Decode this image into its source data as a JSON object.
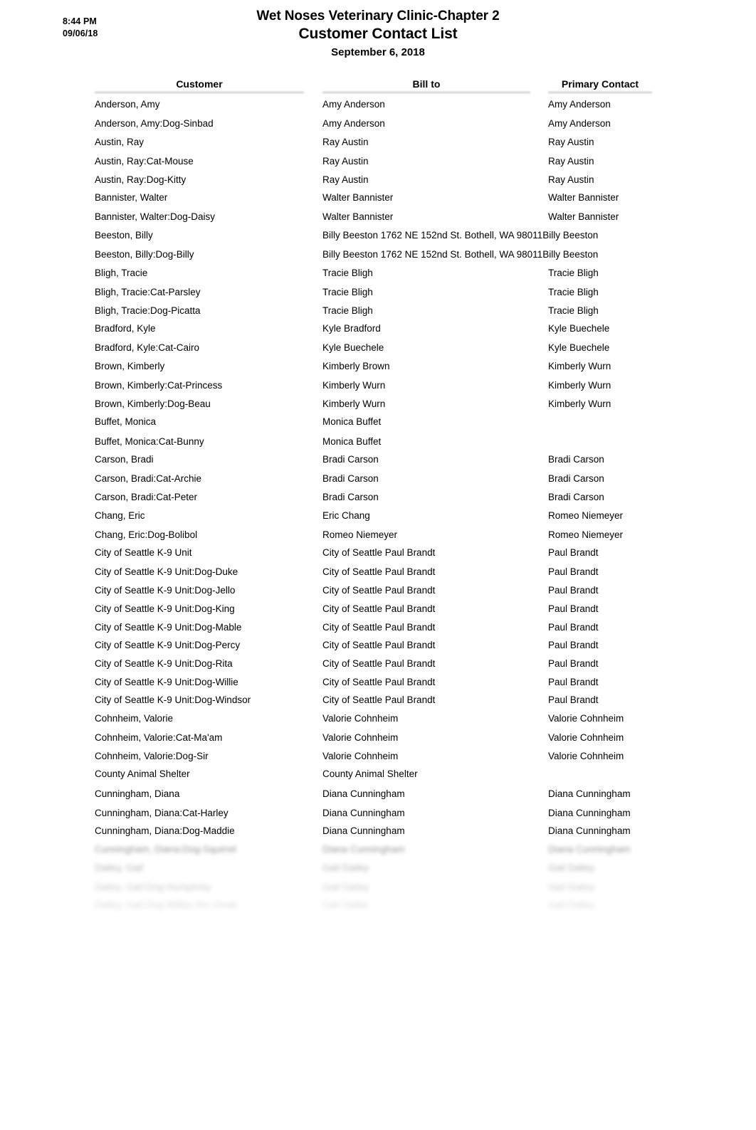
{
  "stamp": {
    "time": "8:44 PM",
    "date": "09/06/18"
  },
  "report": {
    "title": "Wet Noses Veterinary Clinic-Chapter 2",
    "subtitle": "Customer Contact List",
    "date_line": "September 6, 2018"
  },
  "columns": {
    "customer": "Customer",
    "bill_to": "Bill to",
    "primary_contact": "Primary Contact"
  },
  "rows": [
    {
      "customer": "Anderson, Amy",
      "bill_to": "Amy Anderson",
      "primary_contact": "Amy Anderson",
      "group_start": true
    },
    {
      "customer": "Anderson, Amy:Dog-Sinbad",
      "bill_to": "Amy Anderson",
      "primary_contact": "Amy Anderson"
    },
    {
      "customer": "Austin, Ray",
      "bill_to": "Ray Austin",
      "primary_contact": "Ray Austin",
      "group_start": true
    },
    {
      "customer": "Austin, Ray:Cat-Mouse",
      "bill_to": "Ray Austin",
      "primary_contact": "Ray Austin"
    },
    {
      "customer": "Austin, Ray:Dog-Kitty",
      "bill_to": "Ray Austin",
      "primary_contact": "Ray Austin"
    },
    {
      "customer": "Bannister, Walter",
      "bill_to": "Walter Bannister",
      "primary_contact": "Walter Bannister",
      "group_start": true
    },
    {
      "customer": "Bannister, Walter:Dog-Daisy",
      "bill_to": "Walter Bannister",
      "primary_contact": "Walter Bannister"
    },
    {
      "customer": "Beeston, Billy",
      "bill_to": "Billy Beeston 1762 NE 152nd St. Bothell, WA 98011Billy Beeston",
      "primary_contact": "",
      "group_start": true
    },
    {
      "customer": "Beeston, Billy:Dog-Billy",
      "bill_to": "Billy Beeston 1762 NE 152nd St. Bothell, WA 98011Billy Beeston",
      "primary_contact": ""
    },
    {
      "customer": "Bligh, Tracie",
      "bill_to": "Tracie Bligh",
      "primary_contact": "Tracie Bligh",
      "group_start": true
    },
    {
      "customer": "Bligh, Tracie:Cat-Parsley",
      "bill_to": "Tracie Bligh",
      "primary_contact": "Tracie Bligh"
    },
    {
      "customer": "Bligh, Tracie:Dog-Picatta",
      "bill_to": "Tracie Bligh",
      "primary_contact": "Tracie Bligh"
    },
    {
      "customer": "Bradford, Kyle",
      "bill_to": "Kyle Bradford",
      "primary_contact": "Kyle Buechele",
      "group_start": true
    },
    {
      "customer": "Bradford, Kyle:Cat-Cairo",
      "bill_to": "Kyle Buechele",
      "primary_contact": "Kyle Buechele"
    },
    {
      "customer": "Brown, Kimberly",
      "bill_to": "Kimberly Brown",
      "primary_contact": "Kimberly Wurn",
      "group_start": true
    },
    {
      "customer": "Brown, Kimberly:Cat-Princess",
      "bill_to": "Kimberly Wurn",
      "primary_contact": "Kimberly Wurn"
    },
    {
      "customer": "Brown, Kimberly:Dog-Beau",
      "bill_to": "Kimberly Wurn",
      "primary_contact": "Kimberly Wurn"
    },
    {
      "customer": "Buffet, Monica",
      "bill_to": "Monica Buffet",
      "primary_contact": "",
      "group_start": true
    },
    {
      "customer": "Buffet, Monica:Cat-Bunny",
      "bill_to": "Monica Buffet",
      "primary_contact": ""
    },
    {
      "customer": "Carson, Bradi",
      "bill_to": "Bradi Carson",
      "primary_contact": "Bradi Carson",
      "group_start": true
    },
    {
      "customer": "Carson, Bradi:Cat-Archie",
      "bill_to": "Bradi Carson",
      "primary_contact": "Bradi Carson"
    },
    {
      "customer": "Carson, Bradi:Cat-Peter",
      "bill_to": "Bradi Carson",
      "primary_contact": "Bradi Carson"
    },
    {
      "customer": "Chang, Eric",
      "bill_to": "Eric Chang",
      "primary_contact": "Romeo Niemeyer",
      "group_start": true
    },
    {
      "customer": "Chang, Eric:Dog-Bolibol",
      "bill_to": "Romeo Niemeyer",
      "primary_contact": "Romeo Niemeyer"
    },
    {
      "customer": "City of Seattle K-9 Unit",
      "bill_to": "City of Seattle Paul Brandt",
      "primary_contact": "Paul Brandt",
      "group_start": true
    },
    {
      "customer": "City of Seattle K-9 Unit:Dog-Duke",
      "bill_to": "City of Seattle Paul Brandt",
      "primary_contact": "Paul Brandt"
    },
    {
      "customer": "City of Seattle K-9 Unit:Dog-Jello",
      "bill_to": "City of Seattle Paul Brandt",
      "primary_contact": "Paul Brandt"
    },
    {
      "customer": "City of Seattle K-9 Unit:Dog-King",
      "bill_to": "City of Seattle Paul Brandt",
      "primary_contact": "Paul Brandt"
    },
    {
      "customer": "City of Seattle K-9 Unit:Dog-Mable",
      "bill_to": "City of Seattle Paul Brandt",
      "primary_contact": "Paul Brandt"
    },
    {
      "customer": "City of Seattle K-9 Unit:Dog-Percy",
      "bill_to": "City of Seattle Paul Brandt",
      "primary_contact": "Paul Brandt"
    },
    {
      "customer": "City of Seattle K-9 Unit:Dog-Rita",
      "bill_to": "City of Seattle Paul Brandt",
      "primary_contact": "Paul Brandt"
    },
    {
      "customer": "City of Seattle K-9 Unit:Dog-Willie",
      "bill_to": "City of Seattle Paul Brandt",
      "primary_contact": "Paul Brandt"
    },
    {
      "customer": "City of Seattle K-9 Unit:Dog-Windsor",
      "bill_to": "City of Seattle Paul Brandt",
      "primary_contact": "Paul Brandt"
    },
    {
      "customer": "Cohnheim, Valorie",
      "bill_to": "Valorie Cohnheim",
      "primary_contact": "Valorie Cohnheim",
      "group_start": true
    },
    {
      "customer": "Cohnheim, Valorie:Cat-Ma'am",
      "bill_to": "Valorie Cohnheim",
      "primary_contact": "Valorie Cohnheim"
    },
    {
      "customer": "Cohnheim, Valorie:Dog-Sir",
      "bill_to": "Valorie Cohnheim",
      "primary_contact": "Valorie Cohnheim"
    },
    {
      "customer": "County Animal Shelter",
      "bill_to": "County Animal Shelter",
      "primary_contact": "",
      "group_start": true
    },
    {
      "customer": "Cunningham, Diana",
      "bill_to": "Diana Cunningham",
      "primary_contact": "Diana Cunningham",
      "group_start": true
    },
    {
      "customer": "Cunningham, Diana:Cat-Harley",
      "bill_to": "Diana Cunningham",
      "primary_contact": "Diana Cunningham"
    },
    {
      "customer": "Cunningham, Diana:Dog-Maddie",
      "bill_to": "Diana Cunningham",
      "primary_contact": "Diana Cunningham"
    },
    {
      "customer": "Cunningham, Diana:Dog-Squirrel",
      "bill_to": "Diana Cunningham",
      "primary_contact": "Diana Cunningham",
      "fade": 1
    },
    {
      "customer": "Dailey, Gail",
      "bill_to": "Gail Dailey",
      "primary_contact": "Gail Dailey",
      "fade": 2,
      "group_start": true
    },
    {
      "customer": "Dailey, Gail:Dog-Humphrey",
      "bill_to": "Gail Dailey",
      "primary_contact": "Gail Dailey",
      "fade": 3
    },
    {
      "customer": "Dailey, Gail:Dog-Wilbur the Great",
      "bill_to": "Gail Dailey",
      "primary_contact": "Gail Dailey",
      "fade": 4
    }
  ]
}
